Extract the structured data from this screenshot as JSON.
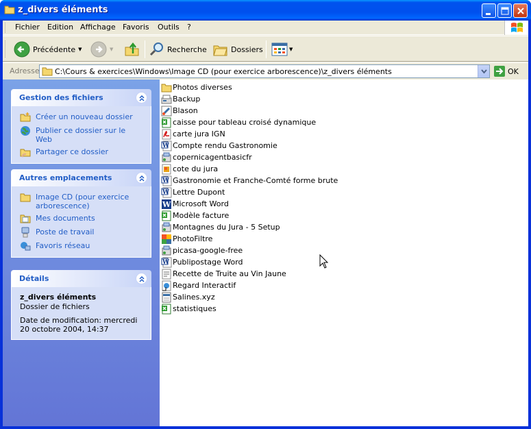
{
  "window": {
    "title": "z_divers éléments"
  },
  "menu": [
    "Fichier",
    "Edition",
    "Affichage",
    "Favoris",
    "Outils",
    "?"
  ],
  "toolbar": {
    "back_label": "Précédente",
    "search_label": "Recherche",
    "folders_label": "Dossiers"
  },
  "address": {
    "label": "Adresse",
    "value": "C:\\Cours & exercices\\Windows\\Image CD (pour exercice arborescence)\\z_divers éléments",
    "go_label": "OK"
  },
  "panels": {
    "file_tasks": {
      "title": "Gestion des fichiers",
      "items": [
        {
          "label": "Créer un nouveau dossier",
          "icon": "new-folder-icon"
        },
        {
          "label": "Publier ce dossier sur le Web",
          "icon": "web-publish-icon"
        },
        {
          "label": "Partager ce dossier",
          "icon": "share-folder-icon"
        }
      ]
    },
    "other_places": {
      "title": "Autres emplacements",
      "items": [
        {
          "label": "Image CD (pour exercice arborescence)",
          "icon": "folder-icon"
        },
        {
          "label": "Mes documents",
          "icon": "my-documents-icon"
        },
        {
          "label": "Poste de travail",
          "icon": "my-computer-icon"
        },
        {
          "label": "Favoris réseau",
          "icon": "network-places-icon"
        }
      ]
    },
    "details": {
      "title": "Détails",
      "name": "z_divers éléments",
      "type": "Dossier de fichiers",
      "date": "Date de modification: mercredi 20 octobre 2004, 14:37"
    }
  },
  "files": [
    {
      "name": "Photos diverses",
      "icon": "folder-icon"
    },
    {
      "name": "Backup",
      "icon": "backup-icon"
    },
    {
      "name": "Blason",
      "icon": "paint-icon"
    },
    {
      "name": "caisse pour tableau croisé dynamique",
      "icon": "excel-icon"
    },
    {
      "name": "carte jura IGN",
      "icon": "pdf-icon"
    },
    {
      "name": "Compte rendu Gastronomie",
      "icon": "word-icon"
    },
    {
      "name": "copernicagentbasicfr",
      "icon": "setup-icon"
    },
    {
      "name": "cote du jura",
      "icon": "image-icon"
    },
    {
      "name": "Gastronomie et Franche-Comté forme brute",
      "icon": "word-icon"
    },
    {
      "name": "Lettre Dupont",
      "icon": "word-icon"
    },
    {
      "name": "Microsoft Word",
      "icon": "word-app-icon"
    },
    {
      "name": "Modèle facture",
      "icon": "excel-icon"
    },
    {
      "name": "Montagnes du Jura - 5 Setup",
      "icon": "setup-icon"
    },
    {
      "name": "PhotoFiltre",
      "icon": "photofiltre-icon"
    },
    {
      "name": "picasa-google-free",
      "icon": "setup-icon"
    },
    {
      "name": "Publipostage Word",
      "icon": "word-icon"
    },
    {
      "name": "Recette de Truite au Vin Jaune",
      "icon": "text-doc-icon"
    },
    {
      "name": "Regard Interactif",
      "icon": "shortcut-icon"
    },
    {
      "name": "Salines.xyz",
      "icon": "generic-file-icon"
    },
    {
      "name": "statistiques",
      "icon": "excel-icon"
    }
  ],
  "colors": {
    "titlebar": "#0054e3",
    "task_link": "#215dc6",
    "pane_gradient_top": "#7ba2e7",
    "pane_gradient_bottom": "#6375d6"
  }
}
